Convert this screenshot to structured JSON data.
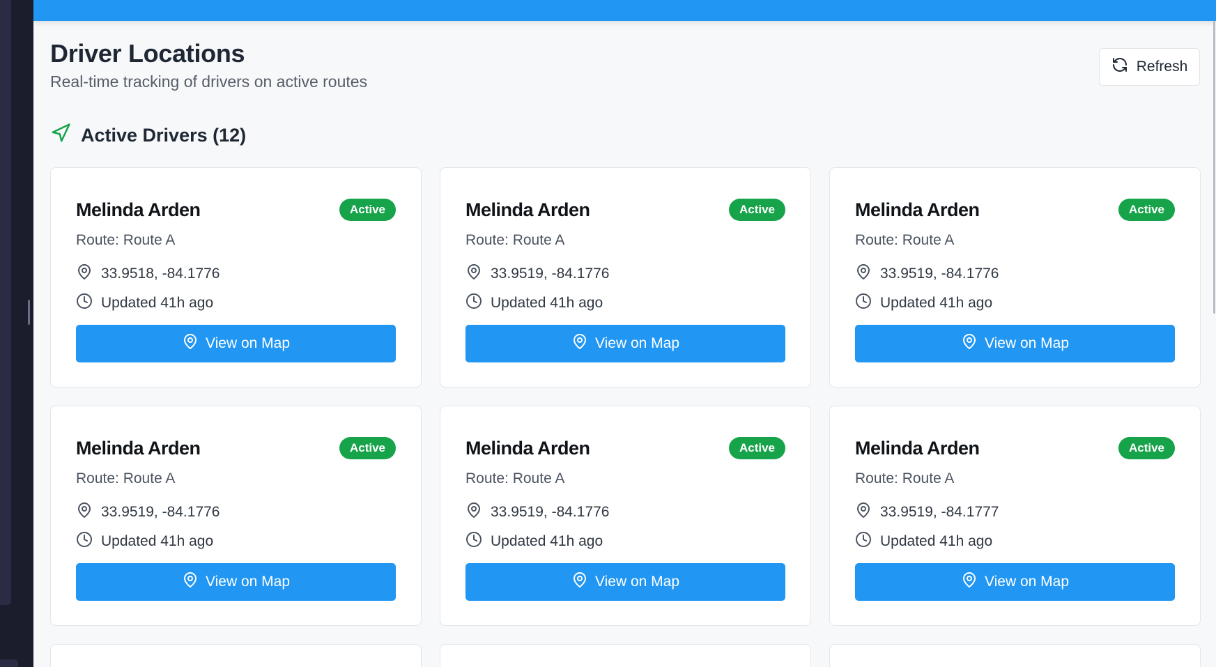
{
  "header": {
    "title": "Driver Locations",
    "subtitle": "Real-time tracking of drivers on active routes",
    "refresh_label": "Refresh"
  },
  "section": {
    "title": "Active Drivers (12)"
  },
  "colors": {
    "primary": "#2196f3",
    "active_badge": "#16a34a",
    "section_icon": "#16a34a"
  },
  "icons": {
    "refresh": "refresh-icon",
    "navigation": "navigation-arrow-icon",
    "pin": "map-pin-icon",
    "clock": "clock-icon"
  },
  "drivers": [
    {
      "name": "Melinda Arden",
      "status": "Active",
      "route": "Route: Route A",
      "coords": "33.9518, -84.1776",
      "updated": "Updated 41h ago",
      "button": "View on Map"
    },
    {
      "name": "Melinda Arden",
      "status": "Active",
      "route": "Route: Route A",
      "coords": "33.9519, -84.1776",
      "updated": "Updated 41h ago",
      "button": "View on Map"
    },
    {
      "name": "Melinda Arden",
      "status": "Active",
      "route": "Route: Route A",
      "coords": "33.9519, -84.1776",
      "updated": "Updated 41h ago",
      "button": "View on Map"
    },
    {
      "name": "Melinda Arden",
      "status": "Active",
      "route": "Route: Route A",
      "coords": "33.9519, -84.1776",
      "updated": "Updated 41h ago",
      "button": "View on Map"
    },
    {
      "name": "Melinda Arden",
      "status": "Active",
      "route": "Route: Route A",
      "coords": "33.9519, -84.1776",
      "updated": "Updated 41h ago",
      "button": "View on Map"
    },
    {
      "name": "Melinda Arden",
      "status": "Active",
      "route": "Route: Route A",
      "coords": "33.9519, -84.1777",
      "updated": "Updated 41h ago",
      "button": "View on Map"
    }
  ]
}
